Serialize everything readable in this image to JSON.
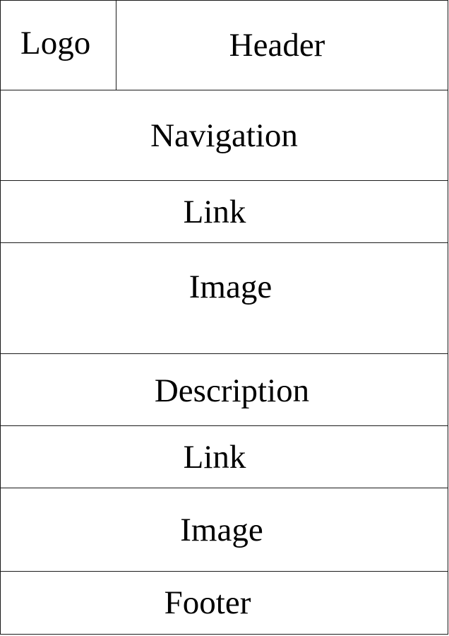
{
  "wireframe": {
    "logo": "Logo",
    "header": "Header",
    "navigation": "Navigation",
    "link_1": "Link",
    "image_1": "Image",
    "description": "Description",
    "link_2": "Link",
    "image_2": "Image",
    "footer": "Footer"
  }
}
